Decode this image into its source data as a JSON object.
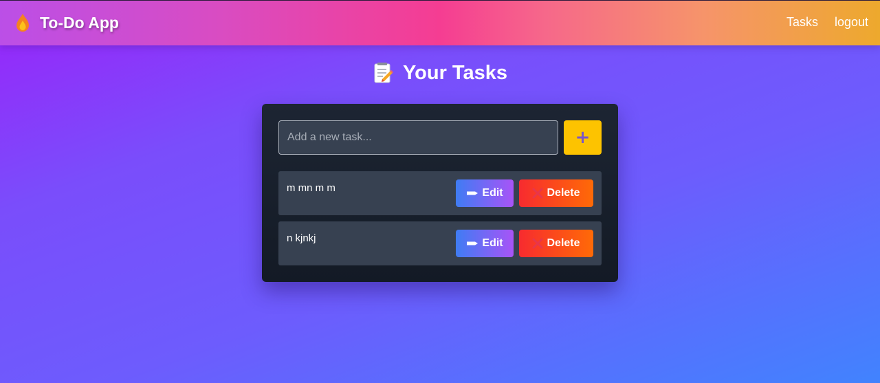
{
  "navbar": {
    "brand_icon": "flame-icon",
    "brand_title": "To-Do App",
    "links": [
      {
        "label": "Tasks"
      },
      {
        "label": "logout"
      }
    ]
  },
  "page": {
    "heading_icon": "memo-icon",
    "title": "Your Tasks"
  },
  "new_task": {
    "placeholder": "Add a new task...",
    "value": "",
    "add_label": "+"
  },
  "tasks": [
    {
      "text": "m mn m m",
      "edit_label": "Edit",
      "delete_label": "Delete"
    },
    {
      "text": "n kjnkj",
      "edit_label": "Edit",
      "delete_label": "Delete"
    }
  ],
  "colors": {
    "accent_yellow": "#fdc300",
    "edit_gradient": [
      "#3f7cf3",
      "#a854f7"
    ],
    "delete_gradient": [
      "#f72b2f",
      "#ff6a07"
    ],
    "card_bg": "#1a2230",
    "row_bg": "#374151"
  }
}
